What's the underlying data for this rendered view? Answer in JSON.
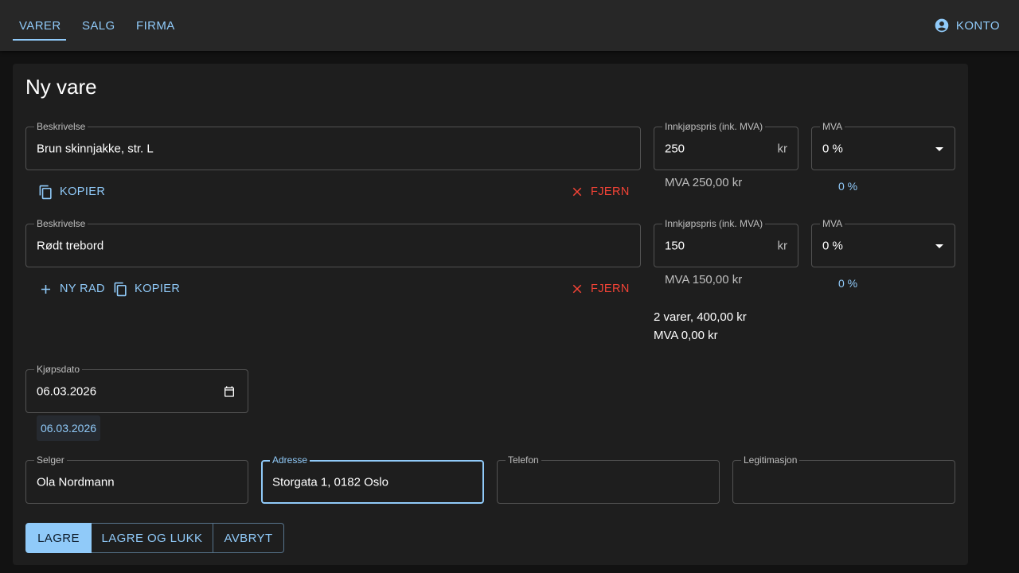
{
  "nav": {
    "tabs": [
      {
        "label": "VARER"
      },
      {
        "label": "SALG"
      },
      {
        "label": "FIRMA"
      }
    ],
    "account_label": "KONTO"
  },
  "page": {
    "title": "Ny vare"
  },
  "items": [
    {
      "description_label": "Beskrivelse",
      "description_value": "Brun skinnjakke, str. L",
      "price_label": "Innkjøpspris (ink. MVA)",
      "price_value": "250",
      "price_unit": "kr",
      "vat_label": "MVA",
      "vat_value": "0 %",
      "vat_helper": "MVA 250,00 kr",
      "vat_rate_helper": "0 %",
      "copy_label": "KOPIER",
      "remove_label": "FJERN"
    },
    {
      "description_label": "Beskrivelse",
      "description_value": "Rødt trebord",
      "price_label": "Innkjøpspris (ink. MVA)",
      "price_value": "150",
      "price_unit": "kr",
      "vat_label": "MVA",
      "vat_value": "0 %",
      "vat_helper": "MVA 150,00 kr",
      "vat_rate_helper": "0 %",
      "new_row_label": "NY RAD",
      "copy_label": "KOPIER",
      "remove_label": "FJERN"
    }
  ],
  "summary": {
    "total": "2 varer, 400,00 kr",
    "vat_total": "MVA 0,00 kr"
  },
  "purchase_date": {
    "label": "Kjøpsdato",
    "value": "06.03.2026",
    "chip": "06.03.2026"
  },
  "seller": {
    "seller_label": "Selger",
    "seller_value": "Ola Nordmann",
    "address_label": "Adresse",
    "address_value": "Storgata 1, 0182 Oslo",
    "phone_label": "Telefon",
    "phone_value": "",
    "id_label": "Legitimasjon",
    "id_value": ""
  },
  "actions": {
    "save": "LAGRE",
    "save_close": "LAGRE OG LUKK",
    "cancel": "AVBRYT"
  },
  "colors": {
    "accent": "#90caf9",
    "danger": "#f44336",
    "paper": "#1e1e1e",
    "appbar": "#272727"
  }
}
